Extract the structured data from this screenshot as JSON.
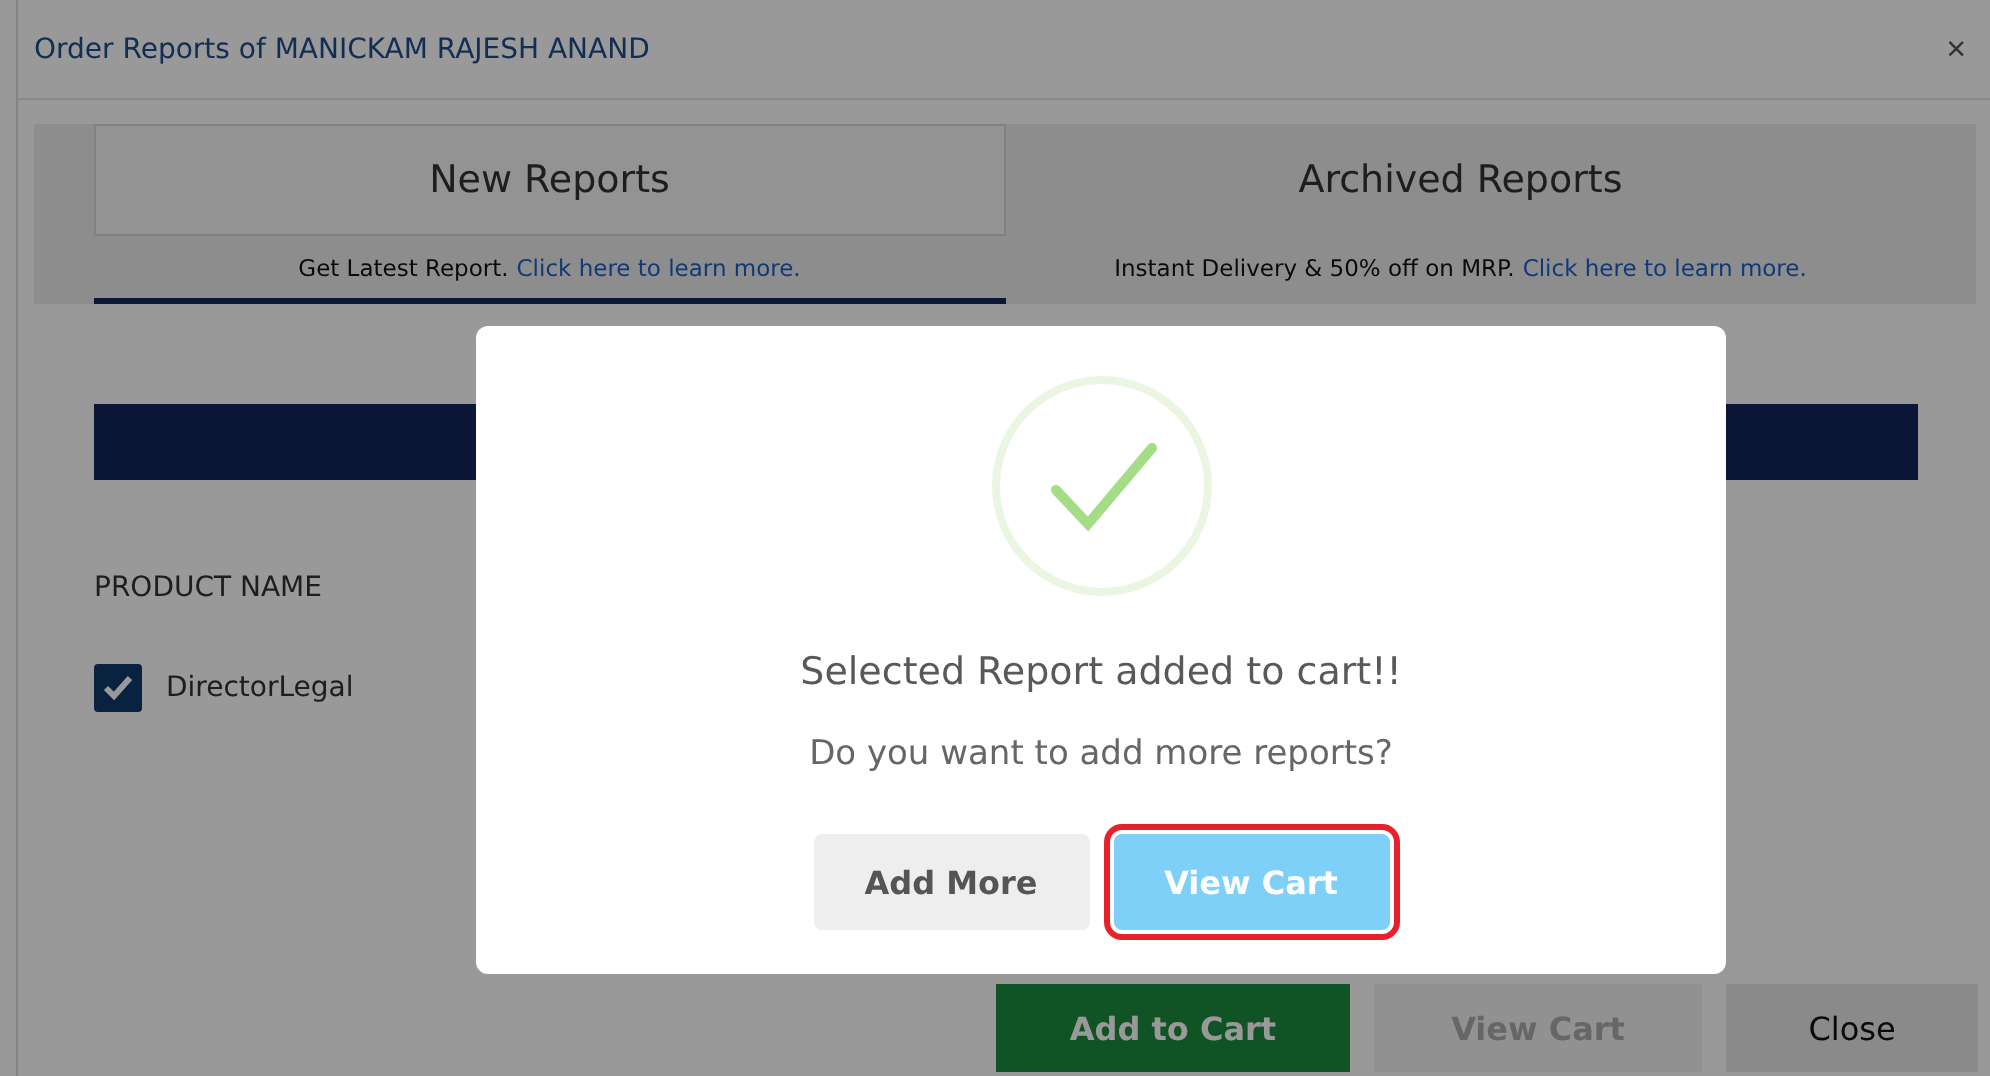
{
  "window": {
    "title": "Order Reports of MANICKAM RAJESH ANAND",
    "close": "×"
  },
  "tabs": [
    {
      "label": "New Reports",
      "note": "Get Latest Report.",
      "link": "Click here to learn more.",
      "selected": true
    },
    {
      "label": "Archived Reports",
      "note": "Instant Delivery & 50% off on MRP.",
      "link": "Click here to learn more.",
      "selected": false
    }
  ],
  "table": {
    "header": "PRODUCT NAME",
    "rows": [
      {
        "name": "DirectorLegal",
        "checked": true
      }
    ]
  },
  "actions": [
    {
      "label": "Add to Cart",
      "kind": "primary"
    },
    {
      "label": "View Cart",
      "kind": "disabled"
    },
    {
      "label": "Close",
      "kind": "secondary"
    }
  ],
  "dialog": {
    "title": "Selected Report added to cart!!",
    "message": "Do you want to add more reports?",
    "buttons": [
      {
        "label": "Add More",
        "kind": "secondary",
        "highlighted": false
      },
      {
        "label": "View Cart",
        "kind": "primary",
        "highlighted": true
      }
    ]
  }
}
